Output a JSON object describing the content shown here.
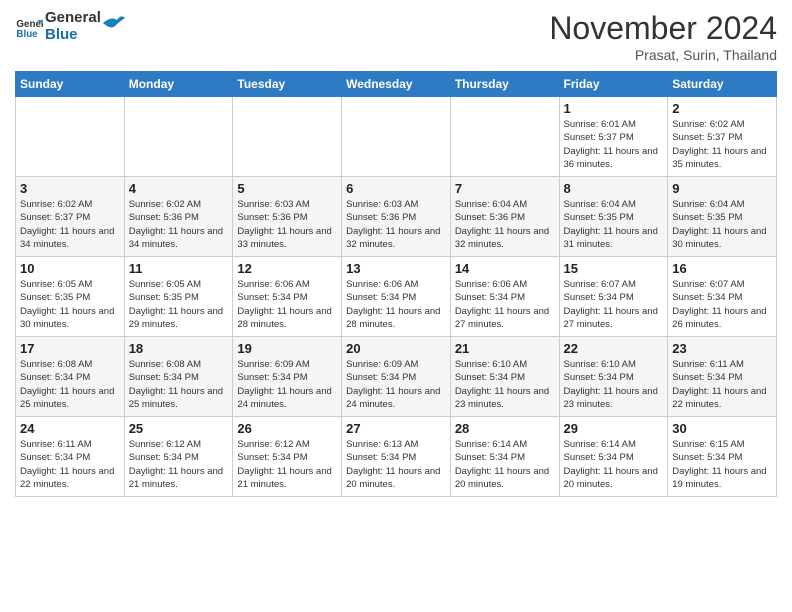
{
  "header": {
    "logo_text_general": "General",
    "logo_text_blue": "Blue",
    "month_title": "November 2024",
    "location": "Prasat, Surin, Thailand"
  },
  "weekdays": [
    "Sunday",
    "Monday",
    "Tuesday",
    "Wednesday",
    "Thursday",
    "Friday",
    "Saturday"
  ],
  "weeks": [
    [
      {
        "day": "",
        "info": ""
      },
      {
        "day": "",
        "info": ""
      },
      {
        "day": "",
        "info": ""
      },
      {
        "day": "",
        "info": ""
      },
      {
        "day": "",
        "info": ""
      },
      {
        "day": "1",
        "info": "Sunrise: 6:01 AM\nSunset: 5:37 PM\nDaylight: 11 hours and 36 minutes."
      },
      {
        "day": "2",
        "info": "Sunrise: 6:02 AM\nSunset: 5:37 PM\nDaylight: 11 hours and 35 minutes."
      }
    ],
    [
      {
        "day": "3",
        "info": "Sunrise: 6:02 AM\nSunset: 5:37 PM\nDaylight: 11 hours and 34 minutes."
      },
      {
        "day": "4",
        "info": "Sunrise: 6:02 AM\nSunset: 5:36 PM\nDaylight: 11 hours and 34 minutes."
      },
      {
        "day": "5",
        "info": "Sunrise: 6:03 AM\nSunset: 5:36 PM\nDaylight: 11 hours and 33 minutes."
      },
      {
        "day": "6",
        "info": "Sunrise: 6:03 AM\nSunset: 5:36 PM\nDaylight: 11 hours and 32 minutes."
      },
      {
        "day": "7",
        "info": "Sunrise: 6:04 AM\nSunset: 5:36 PM\nDaylight: 11 hours and 32 minutes."
      },
      {
        "day": "8",
        "info": "Sunrise: 6:04 AM\nSunset: 5:35 PM\nDaylight: 11 hours and 31 minutes."
      },
      {
        "day": "9",
        "info": "Sunrise: 6:04 AM\nSunset: 5:35 PM\nDaylight: 11 hours and 30 minutes."
      }
    ],
    [
      {
        "day": "10",
        "info": "Sunrise: 6:05 AM\nSunset: 5:35 PM\nDaylight: 11 hours and 30 minutes."
      },
      {
        "day": "11",
        "info": "Sunrise: 6:05 AM\nSunset: 5:35 PM\nDaylight: 11 hours and 29 minutes."
      },
      {
        "day": "12",
        "info": "Sunrise: 6:06 AM\nSunset: 5:34 PM\nDaylight: 11 hours and 28 minutes."
      },
      {
        "day": "13",
        "info": "Sunrise: 6:06 AM\nSunset: 5:34 PM\nDaylight: 11 hours and 28 minutes."
      },
      {
        "day": "14",
        "info": "Sunrise: 6:06 AM\nSunset: 5:34 PM\nDaylight: 11 hours and 27 minutes."
      },
      {
        "day": "15",
        "info": "Sunrise: 6:07 AM\nSunset: 5:34 PM\nDaylight: 11 hours and 27 minutes."
      },
      {
        "day": "16",
        "info": "Sunrise: 6:07 AM\nSunset: 5:34 PM\nDaylight: 11 hours and 26 minutes."
      }
    ],
    [
      {
        "day": "17",
        "info": "Sunrise: 6:08 AM\nSunset: 5:34 PM\nDaylight: 11 hours and 25 minutes."
      },
      {
        "day": "18",
        "info": "Sunrise: 6:08 AM\nSunset: 5:34 PM\nDaylight: 11 hours and 25 minutes."
      },
      {
        "day": "19",
        "info": "Sunrise: 6:09 AM\nSunset: 5:34 PM\nDaylight: 11 hours and 24 minutes."
      },
      {
        "day": "20",
        "info": "Sunrise: 6:09 AM\nSunset: 5:34 PM\nDaylight: 11 hours and 24 minutes."
      },
      {
        "day": "21",
        "info": "Sunrise: 6:10 AM\nSunset: 5:34 PM\nDaylight: 11 hours and 23 minutes."
      },
      {
        "day": "22",
        "info": "Sunrise: 6:10 AM\nSunset: 5:34 PM\nDaylight: 11 hours and 23 minutes."
      },
      {
        "day": "23",
        "info": "Sunrise: 6:11 AM\nSunset: 5:34 PM\nDaylight: 11 hours and 22 minutes."
      }
    ],
    [
      {
        "day": "24",
        "info": "Sunrise: 6:11 AM\nSunset: 5:34 PM\nDaylight: 11 hours and 22 minutes."
      },
      {
        "day": "25",
        "info": "Sunrise: 6:12 AM\nSunset: 5:34 PM\nDaylight: 11 hours and 21 minutes."
      },
      {
        "day": "26",
        "info": "Sunrise: 6:12 AM\nSunset: 5:34 PM\nDaylight: 11 hours and 21 minutes."
      },
      {
        "day": "27",
        "info": "Sunrise: 6:13 AM\nSunset: 5:34 PM\nDaylight: 11 hours and 20 minutes."
      },
      {
        "day": "28",
        "info": "Sunrise: 6:14 AM\nSunset: 5:34 PM\nDaylight: 11 hours and 20 minutes."
      },
      {
        "day": "29",
        "info": "Sunrise: 6:14 AM\nSunset: 5:34 PM\nDaylight: 11 hours and 20 minutes."
      },
      {
        "day": "30",
        "info": "Sunrise: 6:15 AM\nSunset: 5:34 PM\nDaylight: 11 hours and 19 minutes."
      }
    ]
  ]
}
